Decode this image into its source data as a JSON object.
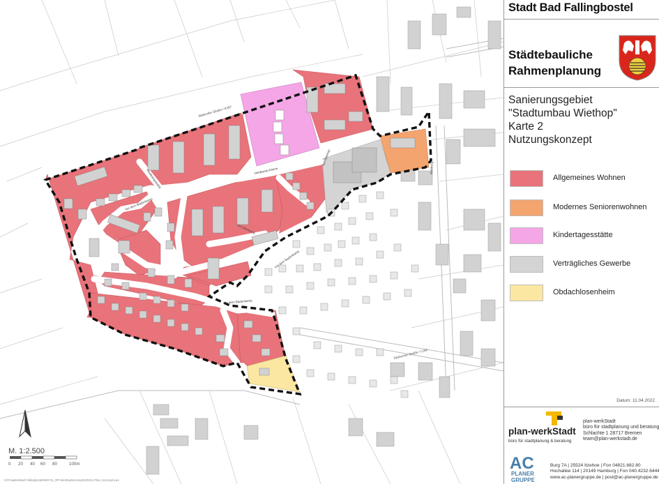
{
  "header": {
    "city": "Stadt Bad Fallingbostel",
    "plan_title_line1": "Städtebauliche",
    "plan_title_line2": "Rahmenplanung"
  },
  "map_info": {
    "line1": "Sanierungsgebiet",
    "line2": "\"Stadtumbau Wiethop\"",
    "line3": "Karte 2",
    "line4": "Nutzungskonzept"
  },
  "legend": [
    {
      "label": "Allgemeines Wohnen",
      "color": "#e8737a"
    },
    {
      "label": "Modernes Seniorenwohnen",
      "color": "#f4a46e"
    },
    {
      "label": "Kindertagesstätte",
      "color": "#f4a6e6"
    },
    {
      "label": "Verträgliches Gewerbe",
      "color": "#d4d4d4"
    },
    {
      "label": "Obdachlosenheim",
      "color": "#fbe7a1"
    }
  ],
  "date": "Datum: 11.04.2022",
  "planwerkstadt": {
    "logo_text": "plan-werkStadt",
    "logo_sub": "büro für stadtplanung & beratung",
    "info_line1": "plan-werkStadt",
    "info_line2": "büro für stadtplanung und beratung",
    "info_line3": "Schlachte 1     28717 Bremen",
    "info_line4": "team@plan-werkstadt.de"
  },
  "acplaner": {
    "logo_text": "AC",
    "logo_sub1": "PLANER",
    "logo_sub2": "GRUPPE",
    "info_line1": "Burg 7A | 25524 Itzehoe | Fon 04821.682.80",
    "info_line2": "Hochallee 114 | 20149 Hamburg | Fon 040.4232.6444",
    "info_line3": "www.ac-planergruppe.de | post@ac-planergruppe.de"
  },
  "scale": {
    "label": "M. 1:2.500",
    "ticks": [
      "0",
      "20",
      "40",
      "60",
      "80",
      "100m"
    ]
  },
  "file_path": "S:\\Projekte\\Bad Fallingbostel\\800741_RP Wiethop\\Konzept\\220411 Plan_Konzept.vwx",
  "street_labels": {
    "walsroder": "Walsroder Straße / K187",
    "heidkampstrasse": "Heidkampstraße",
    "vor_dem_badenkamp": "Vor dem Badenkamp",
    "dusterner": "Düshorner Straße / L163",
    "am_weinberg": "Am Weinberg",
    "am_wiethop": "Am Wiethop",
    "kleine_wiese": "Heidkamp-Kleine",
    "waldweg": "Waldweg"
  },
  "colors": {
    "residential": "#e8737a",
    "senior": "#f4a46e",
    "kita": "#f4a6e6",
    "commercial": "#d4d4d4",
    "shelter": "#fbe7a1",
    "building": "#d2d2d2",
    "road": "#ffffff",
    "boundary": "#111111"
  }
}
